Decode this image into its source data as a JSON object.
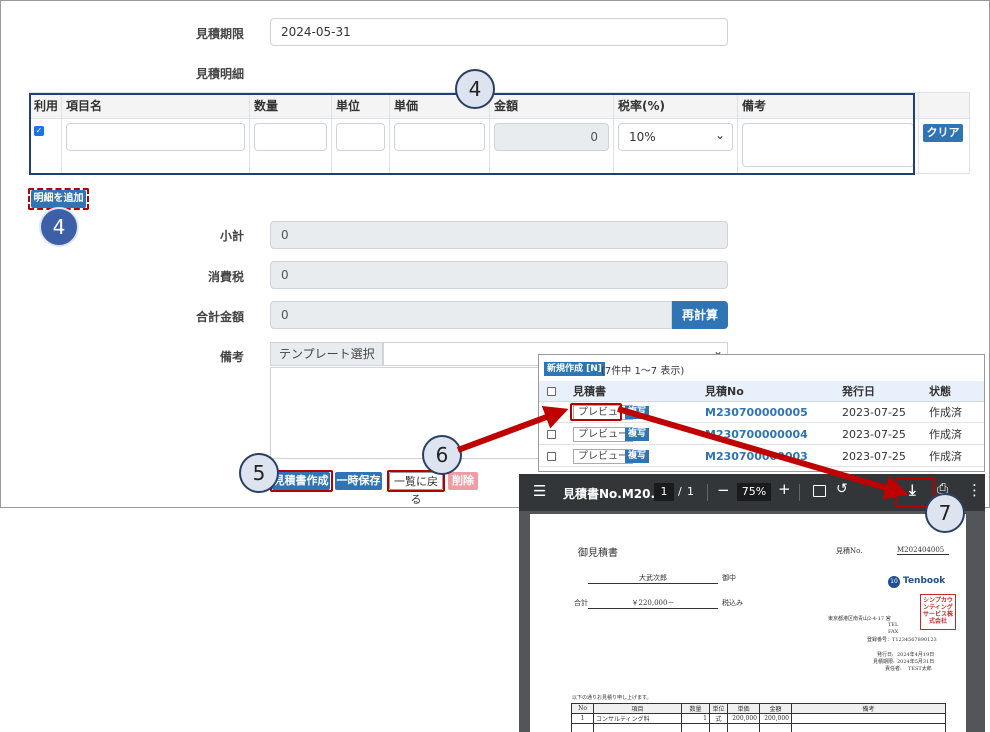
{
  "form": {
    "deadline_label": "見積期限",
    "deadline_value": "2024-05-31",
    "details_label": "見積明細",
    "subtotal_label": "小計",
    "subtotal_value": "0",
    "tax_label": "消費税",
    "tax_value": "0",
    "total_label": "合計金額",
    "total_value": "0",
    "recalc_button": "再計算",
    "remarks_label": "備考",
    "template_label": "テンプレート選択"
  },
  "details_table": {
    "columns": [
      "利用",
      "項目名",
      "数量",
      "単位",
      "単価",
      "金額",
      "税率(%)",
      "備考"
    ],
    "row": {
      "amount": "0",
      "tax_rate": "10%"
    },
    "clear_button": "クリア",
    "add_row_button": "明細を追加"
  },
  "actions": {
    "create_button": "見積書作成",
    "temp_save_button": "一時保存",
    "back_button": "一覧に戻る",
    "delete_button": "削除"
  },
  "callouts": {
    "c4a": "4",
    "c4b": "4",
    "c5": "5",
    "c6": "6",
    "c7": "7"
  },
  "list_popup": {
    "new_button": "新規作成 [N]",
    "count_text": "(7件中 1〜7 表示)",
    "headers": [
      "見積書",
      "見積No",
      "発行日",
      "状態"
    ],
    "preview_label": "プレビュー",
    "copy_label": "複写",
    "rows": [
      {
        "no": "M230700000005",
        "date": "2023-07-25",
        "status": "作成済"
      },
      {
        "no": "M230700000004",
        "date": "2023-07-25",
        "status": "作成済"
      },
      {
        "no": "M230700000003",
        "date": "2023-07-25",
        "status": "作成済"
      }
    ]
  },
  "pdf_viewer": {
    "title": "見積書No.M20...",
    "page_current": "1",
    "page_sep": "/",
    "page_total": "1",
    "zoom": "75%",
    "doc": {
      "heading": "御見積書",
      "number_label": "見積No.",
      "number_value": "M202404005",
      "customer": "大武次郎",
      "honorific": "御中",
      "total_label": "合計",
      "total_value": "￥220,000－",
      "tax_note": "税込み",
      "brand": "Tenbook",
      "stamp": "シンプカウンティングサービス株式会社",
      "address": "東京都港区南青山2-4-17 宮",
      "tel": "TEL",
      "fax": "FAX",
      "reg_no": "登録番号：T1234567890123",
      "issue_date_label": "発行日:",
      "issue_date": "2024年4月19日",
      "deadline_label": "見積期限:",
      "deadline": "2024年5月31日",
      "person_label": "責任者:",
      "person": "TEST太郎",
      "intro": "以下の通りお見積り申し上げます。",
      "table_headers": [
        "No",
        "項目",
        "数量",
        "単位",
        "単価",
        "金額",
        "備考"
      ],
      "table_row": [
        "1",
        "コンサルティング料",
        "1",
        "式",
        "200,000",
        "200,000",
        ""
      ]
    }
  }
}
